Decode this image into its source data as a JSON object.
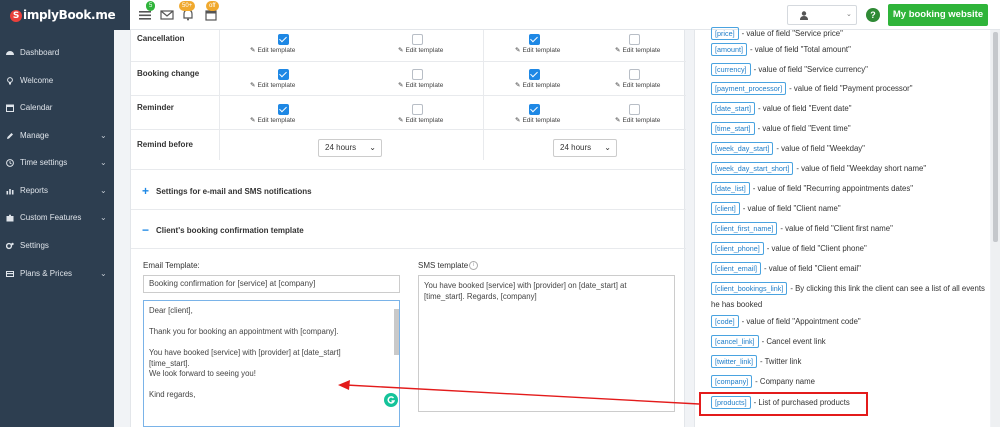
{
  "header": {
    "logo_text": "implyBook.me",
    "logo_letter": "S",
    "badges": [
      "5",
      "50+",
      "off"
    ],
    "cta_label": "My booking website",
    "help_label": "?"
  },
  "sidebar": {
    "items": [
      {
        "label": "Dashboard",
        "icon": "dashboard-icon",
        "chevron": false
      },
      {
        "label": "Welcome",
        "icon": "bulb-icon",
        "chevron": false
      },
      {
        "label": "Calendar",
        "icon": "calendar-icon",
        "chevron": false
      },
      {
        "label": "Manage",
        "icon": "pencil-icon",
        "chevron": true
      },
      {
        "label": "Time settings",
        "icon": "clock-icon",
        "chevron": true
      },
      {
        "label": "Reports",
        "icon": "bar-chart-icon",
        "chevron": true
      },
      {
        "label": "Custom Features",
        "icon": "puzzle-icon",
        "chevron": true
      },
      {
        "label": "Settings",
        "icon": "gears-icon",
        "chevron": false
      },
      {
        "label": "Plans & Prices",
        "icon": "card-icon",
        "chevron": true
      }
    ]
  },
  "notifications": {
    "edit_label": "Edit template",
    "rows": [
      {
        "label": "Cancellation",
        "checks": [
          true,
          false,
          true,
          false
        ]
      },
      {
        "label": "Booking change",
        "checks": [
          true,
          false,
          true,
          false
        ]
      },
      {
        "label": "Reminder",
        "checks": [
          true,
          false,
          true,
          false
        ]
      }
    ],
    "remind_before_label": "Remind before",
    "remind_values": [
      "24 hours",
      "24 hours"
    ]
  },
  "sections": {
    "settings_title": "Settings for e-mail and SMS notifications",
    "settings_sign": "+",
    "booking_title": "Client's booking confirmation template",
    "booking_sign": "−"
  },
  "template": {
    "email_label": "Email Template:",
    "subject_value": "Booking confirmation for [service] at [company]",
    "email_body": "Dear [client],\n\nThank you for booking an appointment with [company].\n\nYou have booked [service] with [provider] at [date_start]\n[time_start].\nWe look forward to seeing you!\n\nKind regards,",
    "sms_label": "SMS template",
    "sms_body": "You have booked [service] with [provider] on [date_start] at\n[time_start]. Regards, [company]"
  },
  "variables": [
    {
      "tag": "[price]",
      "desc": "- value of field \"Service price\""
    },
    {
      "tag": "[amount]",
      "desc": "- value of field \"Total amount\""
    },
    {
      "tag": "[currency]",
      "desc": "- value of field \"Service currency\""
    },
    {
      "tag": "[payment_processor]",
      "desc": "- value of field \"Payment processor\""
    },
    {
      "tag": "[date_start]",
      "desc": "- value of field \"Event date\""
    },
    {
      "tag": "[time_start]",
      "desc": "- value of field \"Event time\""
    },
    {
      "tag": "[week_day_start]",
      "desc": "- value of field \"Weekday\""
    },
    {
      "tag": "[week_day_start_short]",
      "desc": "- value of field \"Weekday short name\""
    },
    {
      "tag": "[date_list]",
      "desc": "- value of field \"Recurring appointments dates\""
    },
    {
      "tag": "[client]",
      "desc": "- value of field \"Client name\""
    },
    {
      "tag": "[client_first_name]",
      "desc": "- value of field \"Client first name\""
    },
    {
      "tag": "[client_phone]",
      "desc": "- value of field \"Client phone\""
    },
    {
      "tag": "[client_email]",
      "desc": "- value of field \"Client email\""
    },
    {
      "tag": "[client_bookings_link]",
      "desc": "- By clicking this link the client can see a list of all events"
    },
    {
      "tag": "",
      "desc": "he has booked"
    },
    {
      "tag": "[code]",
      "desc": "- value of field \"Appointment code\""
    },
    {
      "tag": "[cancel_link]",
      "desc": "- Cancel event link"
    },
    {
      "tag": "[twitter_link]",
      "desc": "- Twitter link"
    },
    {
      "tag": "[company]",
      "desc": "- Company name"
    },
    {
      "tag": "[products]",
      "desc": "- List of purchased products"
    }
  ],
  "colors": {
    "sidebar": "#2d3e50",
    "accent": "#1e88e5",
    "cta": "#2fb43a",
    "annotation": "#e31b1b"
  }
}
